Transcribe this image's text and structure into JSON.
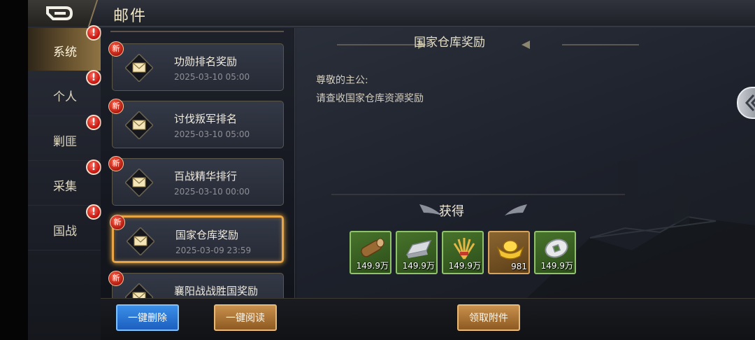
{
  "header": {
    "title": "邮件",
    "back_icon": "back-arrow-icon"
  },
  "tabs": [
    {
      "label": "系统",
      "active": true,
      "alert": "!"
    },
    {
      "label": "个人",
      "active": false,
      "alert": "!"
    },
    {
      "label": "剿匪",
      "active": false,
      "alert": "!"
    },
    {
      "label": "采集",
      "active": false,
      "alert": "!"
    },
    {
      "label": "国战",
      "active": false,
      "alert": "!"
    }
  ],
  "mails": [
    {
      "badge": "新",
      "subject": "功勋排名奖励",
      "date": "2025-03-10   05:00"
    },
    {
      "badge": "新",
      "subject": "讨伐叛军排名",
      "date": "2025-03-10   05:00"
    },
    {
      "badge": "新",
      "subject": "百战精华排行",
      "date": "2025-03-10   00:00"
    },
    {
      "badge": "新",
      "subject": "国家仓库奖励",
      "date": "2025-03-09   23:59",
      "selected": true
    },
    {
      "badge": "新",
      "subject": "襄阳战战胜国奖励",
      "date": ""
    }
  ],
  "detail": {
    "title": "国家仓库奖励",
    "greeting": "尊敬的主公:",
    "content": "请查收国家仓库资源奖励",
    "rewards_title": "获得",
    "rewards": [
      {
        "icon": "wood-log-icon",
        "qty": "149.9万",
        "rarity": "green"
      },
      {
        "icon": "iron-ingot-icon",
        "qty": "149.9万",
        "rarity": "green"
      },
      {
        "icon": "wheat-bundle-icon",
        "qty": "149.9万",
        "rarity": "green"
      },
      {
        "icon": "gold-ingot-icon",
        "qty": "981",
        "rarity": "gold"
      },
      {
        "icon": "copper-coin-icon",
        "qty": "149.9万",
        "rarity": "green"
      }
    ]
  },
  "buttons": {
    "delete_all": "一键删除",
    "read_all": "一键阅读",
    "claim": "领取附件"
  },
  "colors": {
    "accent": "#e8a547",
    "alert": "#c4120e",
    "blue_button": "#1d5fbf",
    "bronze_button": "#8d5a22"
  }
}
